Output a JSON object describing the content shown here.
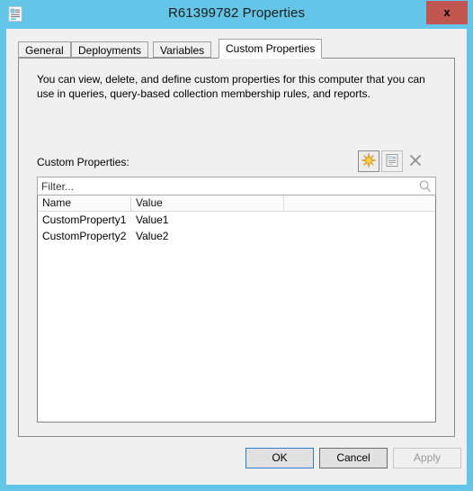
{
  "window": {
    "title": "R61399782 Properties",
    "icon": "properties-document-icon",
    "close_label": "x",
    "frame_color": "#63c6e8",
    "close_button_color": "#c0564f"
  },
  "tabs": [
    {
      "label": "General",
      "active": false
    },
    {
      "label": "Deployments",
      "active": false
    },
    {
      "label": "Variables",
      "active": false
    },
    {
      "label": "Custom Properties",
      "active": true
    }
  ],
  "page": {
    "description": "You can view, delete, and define custom properties for this computer that you can use in queries, query-based collection membership rules, and reports.",
    "properties_label": "Custom Properties:"
  },
  "toolbar": {
    "new_icon": "new-star-icon",
    "edit_icon": "properties-icon",
    "delete_icon": "delete-x-icon"
  },
  "filter": {
    "placeholder": "Filter...",
    "value": "",
    "search_icon": "search-magnifier-icon"
  },
  "list": {
    "columns": [
      "Name",
      "Value"
    ],
    "rows": [
      {
        "name": "CustomProperty1",
        "value": "Value1"
      },
      {
        "name": "CustomProperty2",
        "value": "Value2"
      }
    ]
  },
  "buttons": {
    "ok": "OK",
    "cancel": "Cancel",
    "apply": "Apply",
    "apply_enabled": false
  }
}
